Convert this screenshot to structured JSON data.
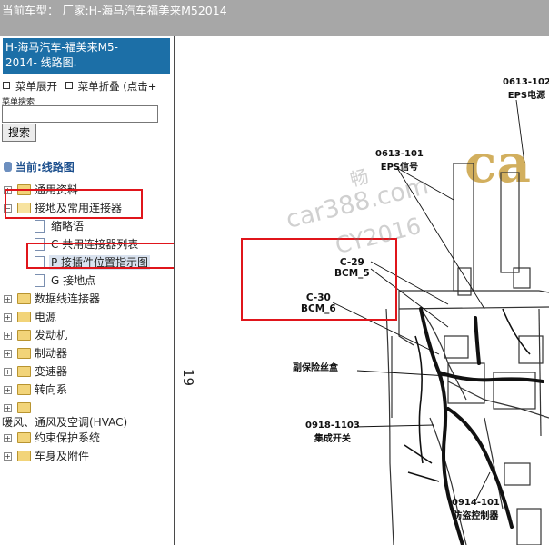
{
  "topbar": {
    "text": "当前车型：  厂家:H-海马汽车福美来M52014"
  },
  "sidebar": {
    "title_line1": "H-海马汽车-福美来M5-",
    "title_line2": "2014- 线路图.",
    "menu_expand": "菜单展开",
    "menu_collapse": "菜单折叠 (点击+",
    "search_label": "菜单搜索",
    "search_value": "",
    "search_button": "搜索",
    "current_label": "当前:线路图",
    "tree": [
      {
        "label": "通用资料",
        "type": "folder"
      },
      {
        "label": "接地及常用连接器",
        "type": "folder-open"
      },
      {
        "label": "缩略语",
        "type": "doc"
      },
      {
        "label": "C 共用连接器列表",
        "type": "doc"
      },
      {
        "label": "P 接插件位置指示图",
        "type": "doc",
        "selected": true
      },
      {
        "label": "G 接地点",
        "type": "doc"
      },
      {
        "label": "数据线连接器",
        "type": "folder"
      },
      {
        "label": "电源",
        "type": "folder"
      },
      {
        "label": "发动机",
        "type": "folder"
      },
      {
        "label": "制动器",
        "type": "folder"
      },
      {
        "label": "变速器",
        "type": "folder"
      },
      {
        "label": "转向系",
        "type": "folder"
      },
      {
        "label": "",
        "type": "folder"
      },
      {
        "label": "暖风、通风及空调(HVAC)",
        "type": "text"
      },
      {
        "label": "约束保护系统",
        "type": "folder"
      },
      {
        "label": "车身及附件",
        "type": "folder"
      }
    ]
  },
  "diagram": {
    "page_number": "19",
    "watermark_1": "car388.com",
    "watermark_2": "CY2016",
    "watermark_3": "畅",
    "logo_text": "ca",
    "labels": [
      {
        "code": "0613-102",
        "name": "EPS电源"
      },
      {
        "code": "0613-101",
        "name": "EPS信号"
      },
      {
        "code": "C-29",
        "name": "BCM_5"
      },
      {
        "code": "C-30",
        "name": "BCM_6"
      },
      {
        "code": "",
        "name": "副保险丝盒"
      },
      {
        "code": "0918-1103",
        "name": "集成开关"
      },
      {
        "code": "0914-101",
        "name": "防盗控制器"
      }
    ]
  },
  "colors": {
    "accent": "#1c6fa7",
    "highlight": "#e0151b",
    "topbar": "#a7a7a7"
  }
}
